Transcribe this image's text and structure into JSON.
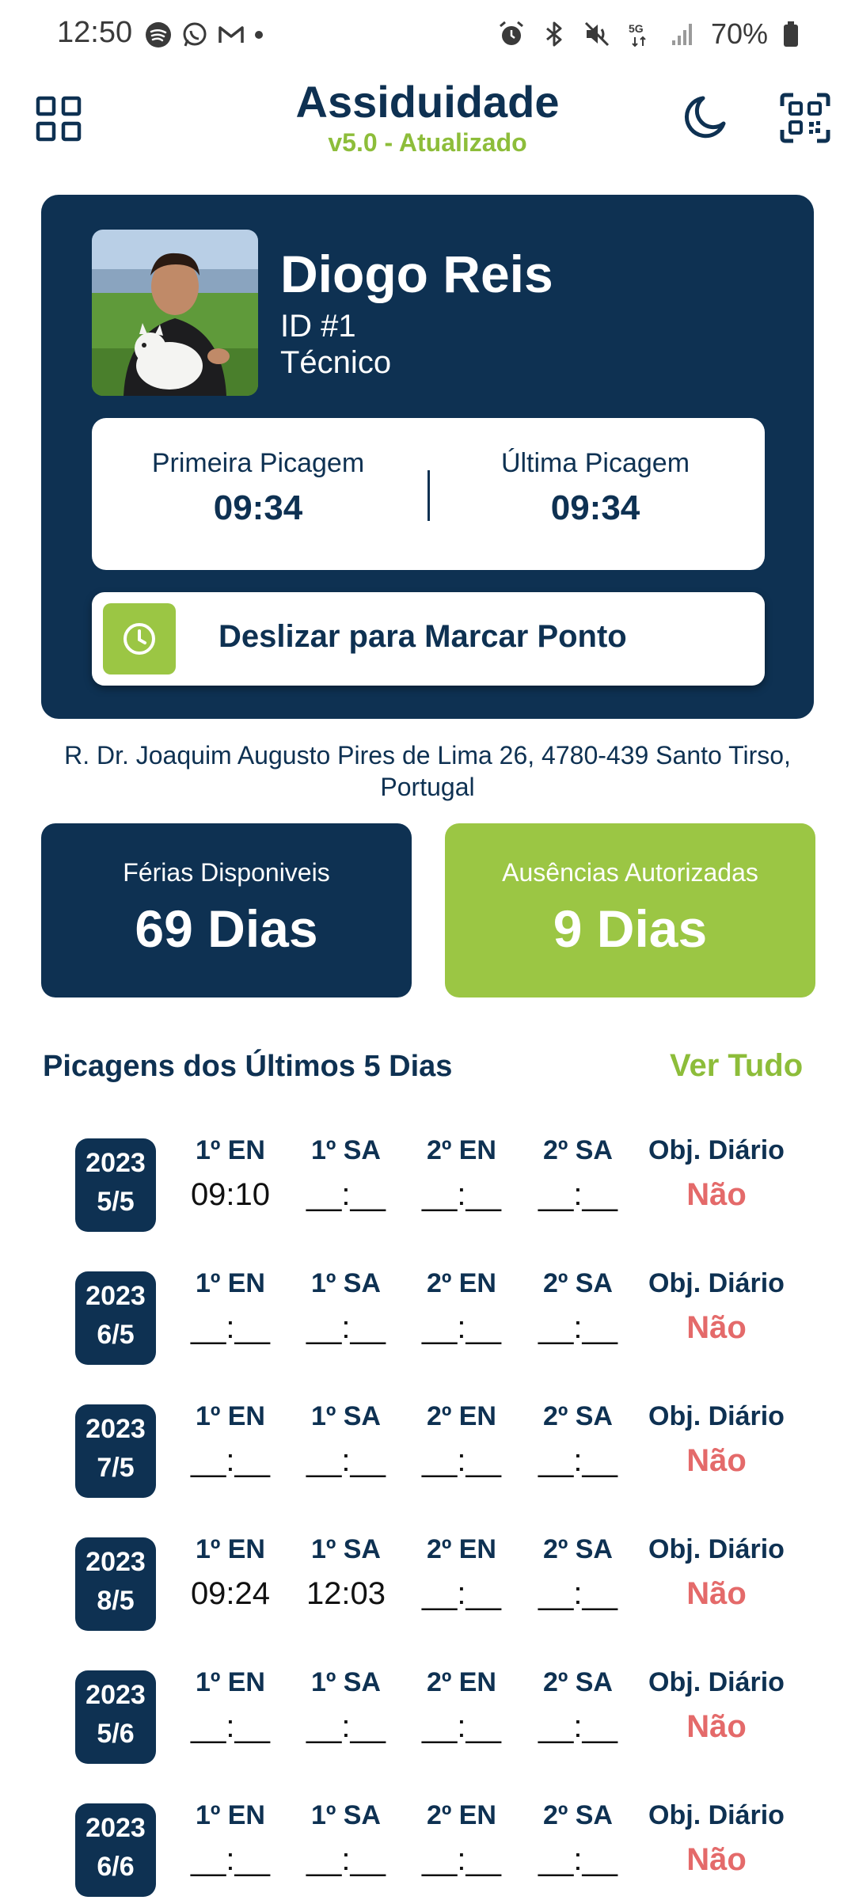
{
  "status_bar": {
    "time": "12:50",
    "battery": "70%",
    "left_icons": [
      "spotify-icon",
      "whatsapp-icon",
      "gmail-icon",
      "dot-icon"
    ],
    "right_icons": [
      "alarm-icon",
      "bluetooth-icon",
      "mute-icon",
      "5g-icon",
      "signal-icon",
      "battery-icon"
    ]
  },
  "header": {
    "title": "Assiduidade",
    "version": "v5.0 - Atualizado"
  },
  "profile": {
    "name": "Diogo Reis",
    "id": "ID #1",
    "role": "Técnico"
  },
  "punch": {
    "first_label": "Primeira Picagem",
    "first_time": "09:34",
    "last_label": "Última Picagem",
    "last_time": "09:34"
  },
  "swipe": {
    "label": "Deslizar para Marcar Ponto"
  },
  "address": "R. Dr. Joaquim Augusto Pires de Lima 26, 4780-439 Santo Tirso, Portugal",
  "stats": {
    "vacation_label": "Férias Disponiveis",
    "vacation_value": "69 Dias",
    "absence_label": "Ausências Autorizadas",
    "absence_value": "9 Dias"
  },
  "history": {
    "title": "Picagens dos Últimos 5 Dias",
    "see_all": "Ver Tudo",
    "headers": [
      "1º EN",
      "1º SA",
      "2º EN",
      "2º SA",
      "Obj. Diário"
    ],
    "rows": [
      {
        "year": "2023",
        "date": "5/5",
        "e1": "09:10",
        "s1": "__:__",
        "e2": "__:__",
        "s2": "__:__",
        "objective": "Não"
      },
      {
        "year": "2023",
        "date": "6/5",
        "e1": "__:__",
        "s1": "__:__",
        "e2": "__:__",
        "s2": "__:__",
        "objective": "Não"
      },
      {
        "year": "2023",
        "date": "7/5",
        "e1": "__:__",
        "s1": "__:__",
        "e2": "__:__",
        "s2": "__:__",
        "objective": "Não"
      },
      {
        "year": "2023",
        "date": "8/5",
        "e1": "09:24",
        "s1": "12:03",
        "e2": "__:__",
        "s2": "__:__",
        "objective": "Não"
      },
      {
        "year": "2023",
        "date": "5/6",
        "e1": "__:__",
        "s1": "__:__",
        "e2": "__:__",
        "s2": "__:__",
        "objective": "Não"
      },
      {
        "year": "2023",
        "date": "6/6",
        "e1": "__:__",
        "s1": "__:__",
        "e2": "__:__",
        "s2": "__:__",
        "objective": "Não"
      }
    ]
  },
  "colors": {
    "navy": "#0e3152",
    "green": "#9bc644",
    "green_text": "#8dbd3a",
    "red": "#e46a6a"
  }
}
